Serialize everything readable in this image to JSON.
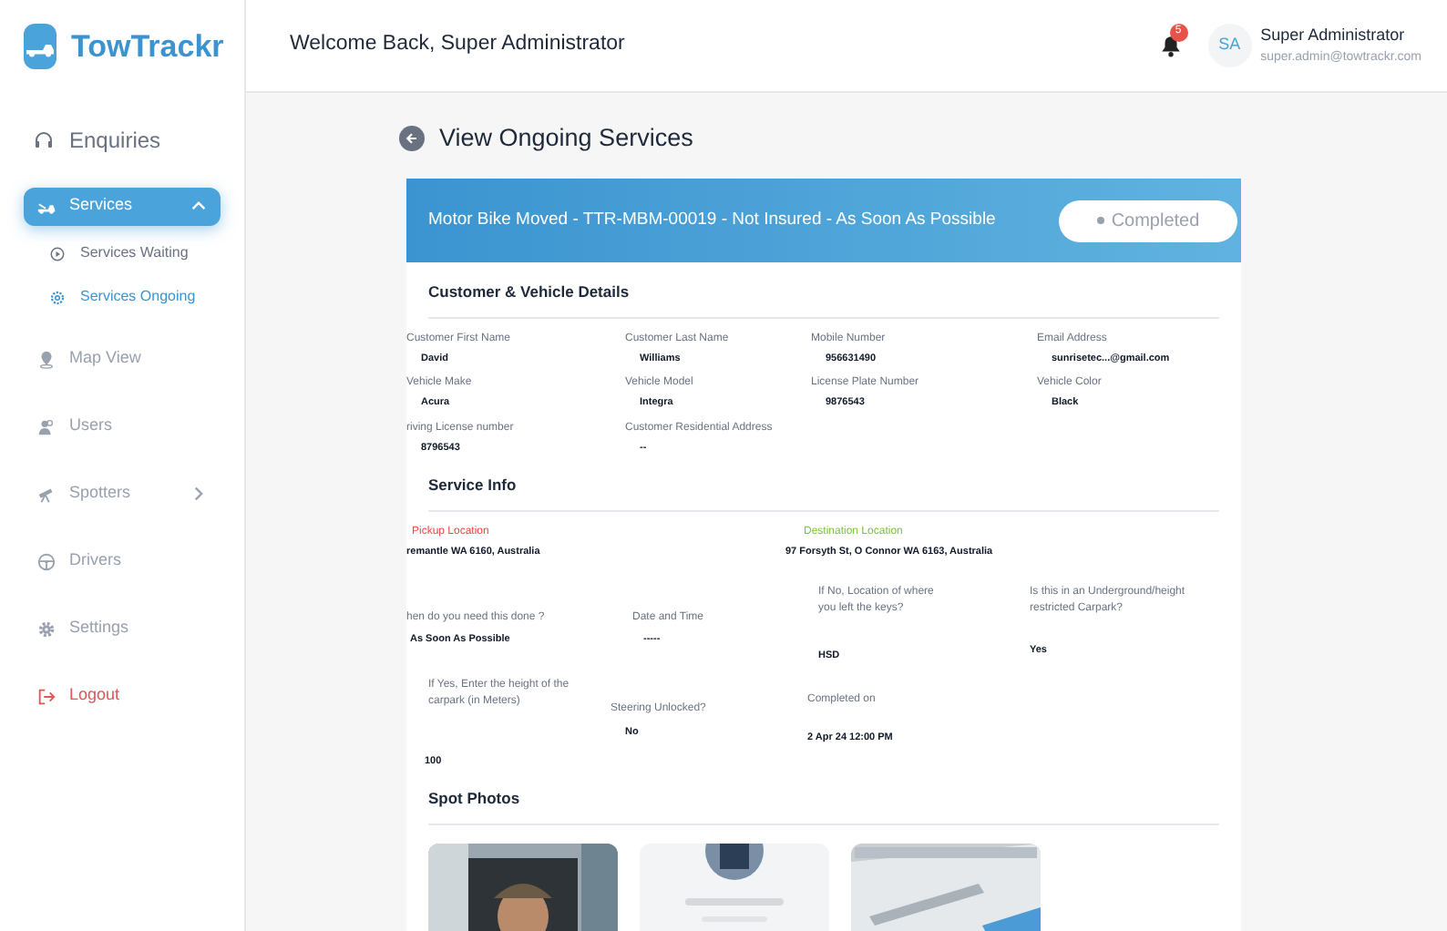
{
  "brand": "TowTrackr",
  "sidebar": {
    "items": [
      {
        "label": "Enquiries",
        "selected": false,
        "kind": "top"
      },
      {
        "label": "Services",
        "selected": true,
        "kind": "group",
        "expanded": true,
        "children": [
          {
            "label": "Services Waiting",
            "selected": false
          },
          {
            "label": "Services Ongoing",
            "selected": true
          }
        ]
      },
      {
        "label": "Map View",
        "selected": false,
        "kind": "item"
      },
      {
        "label": "Users",
        "selected": false,
        "kind": "item"
      },
      {
        "label": "Spotters",
        "selected": false,
        "kind": "group",
        "expanded": false
      },
      {
        "label": "Drivers",
        "selected": false,
        "kind": "item"
      },
      {
        "label": "Settings",
        "selected": false,
        "kind": "item"
      },
      {
        "label": "Logout",
        "selected": false,
        "kind": "danger"
      }
    ]
  },
  "header": {
    "welcome": "Welcome Back, Super Administrator",
    "notifications": "5",
    "avatar": "SA",
    "user_name": "Super Administrator",
    "user_email": "super.admin@towtrackr.com"
  },
  "page_title": "View Ongoing Services",
  "service": {
    "title": "Motor Bike Moved - TTR-MBM-00019 - Not Insured - As Soon As Possible",
    "status": "Completed"
  },
  "customer_section": {
    "title": "Customer & Vehicle Details",
    "fields": [
      {
        "label": "Customer First Name",
        "value": "David"
      },
      {
        "label": "Customer Last  Name",
        "value": "Williams"
      },
      {
        "label": "Mobile Number",
        "value": "956631490"
      },
      {
        "label": "Email Address",
        "value": "sunrisetec...@gmail.com"
      },
      {
        "label": "Vehicle Make",
        "value": "Acura"
      },
      {
        "label": "Vehicle Model",
        "value": "Integra"
      },
      {
        "label": "License Plate Number",
        "value": "9876543"
      },
      {
        "label": "Vehicle Color",
        "value": "Black"
      },
      {
        "label": "riving License number",
        "value": "8796543"
      },
      {
        "label": "Customer Residential Address",
        "value": "--"
      }
    ]
  },
  "service_section": {
    "title": "Service Info",
    "locations": [
      {
        "label": "Pickup Location",
        "value": "remantle WA 6160, Australia",
        "color": "#ef4444"
      },
      {
        "label": "Destination Location",
        "value": "97 Forsyth St, O Connor WA 6163, Australia",
        "color": "#7cc242"
      }
    ],
    "fields": [
      {
        "label": "hen do you need this done ?",
        "value": "As Soon As Possible"
      },
      {
        "label": "Date and Time",
        "value": "-----"
      },
      {
        "label": "If No, Location of where you left the keys?",
        "value": "HSD"
      },
      {
        "label": "Is this in an Underground/height restricted Carpark?",
        "value": "Yes"
      },
      {
        "label": "If Yes, Enter the height of the carpark (in Meters)",
        "value": "100"
      },
      {
        "label": "Steering Unlocked?",
        "value": "No"
      },
      {
        "label": "Completed on",
        "value": "2 Apr 24 12:00 PM"
      }
    ]
  },
  "photos_section": {
    "title": "Spot Photos"
  }
}
